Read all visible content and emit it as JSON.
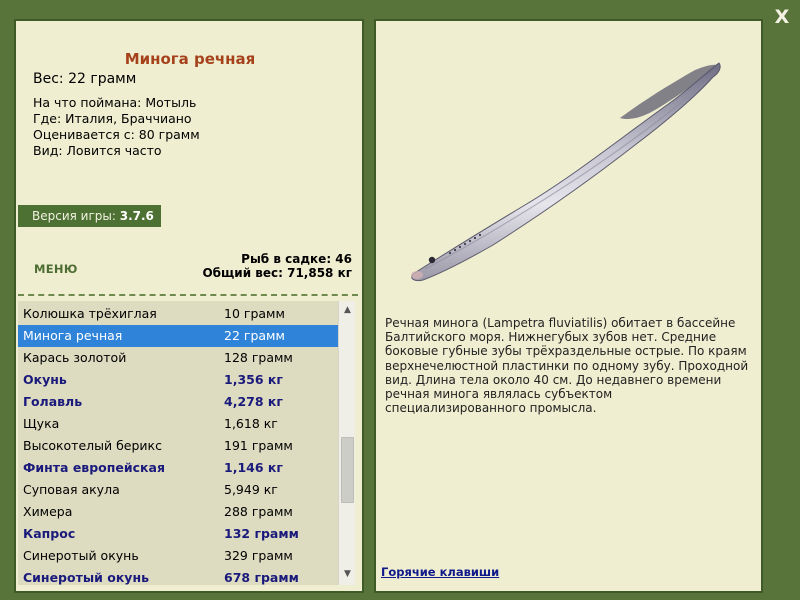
{
  "window": {
    "close_label": "X"
  },
  "fish_info": {
    "title": "Минога речная",
    "weight": "Вес: 22 грамм",
    "bait": "На что поймана: Мотыль",
    "location": "Где: Италия, Браччиано",
    "valued_from": "Оценивается с: 80 грамм",
    "species_note": "Вид: Ловится часто"
  },
  "version": {
    "label": "Версия игры:",
    "number": "3.7.6"
  },
  "menu": {
    "label": "МЕНЮ"
  },
  "cage": {
    "fish_count": "Рыб в садке: 46",
    "total_weight": "Общий вес: 71,858 кг"
  },
  "catch_list": [
    {
      "name": "Колюшка трёхиглая",
      "weight": "10 грамм",
      "bold": false,
      "selected": false
    },
    {
      "name": "Минога речная",
      "weight": "22 грамм",
      "bold": false,
      "selected": true
    },
    {
      "name": "Карась золотой",
      "weight": "128 грамм",
      "bold": false,
      "selected": false
    },
    {
      "name": "Окунь",
      "weight": "1,356 кг",
      "bold": true,
      "selected": false
    },
    {
      "name": "Голавль",
      "weight": "4,278 кг",
      "bold": true,
      "selected": false
    },
    {
      "name": "Щука",
      "weight": "1,618 кг",
      "bold": false,
      "selected": false
    },
    {
      "name": "Высокотелый берикс",
      "weight": "191 грамм",
      "bold": false,
      "selected": false
    },
    {
      "name": "Финта европейская",
      "weight": "1,146 кг",
      "bold": true,
      "selected": false
    },
    {
      "name": "Суповая акула",
      "weight": "5,949 кг",
      "bold": false,
      "selected": false
    },
    {
      "name": "Химера",
      "weight": "288 грамм",
      "bold": false,
      "selected": false
    },
    {
      "name": "Капрос",
      "weight": "132 грамм",
      "bold": true,
      "selected": false
    },
    {
      "name": "Синеротый окунь",
      "weight": "329 грамм",
      "bold": false,
      "selected": false
    },
    {
      "name": "Синеротый окунь",
      "weight": "678 грамм",
      "bold": true,
      "selected": false
    }
  ],
  "description": "Речная минога (Lampetra fluviatilis) обитает в бассейне Балтийского моря. Нижнегубых зубов нет. Средние боковые губные зубы трёхраздельные острые. По краям верхнечелюстной пластинки по одному зубу. Проходной вид. Длина тела около 40 см. До недавнего времени речная минога являлась субъектом специализированного промысла.",
  "hotkeys": {
    "label": "Горячие клавиши"
  },
  "colors": {
    "background": "#58743a",
    "panel": "#f0eed0",
    "list_bg": "#dddbc0",
    "title": "#a5421c",
    "bold_rows": "#1a1a7c",
    "selected_row": "#2f83d9",
    "version_badge": "#4d7133"
  }
}
